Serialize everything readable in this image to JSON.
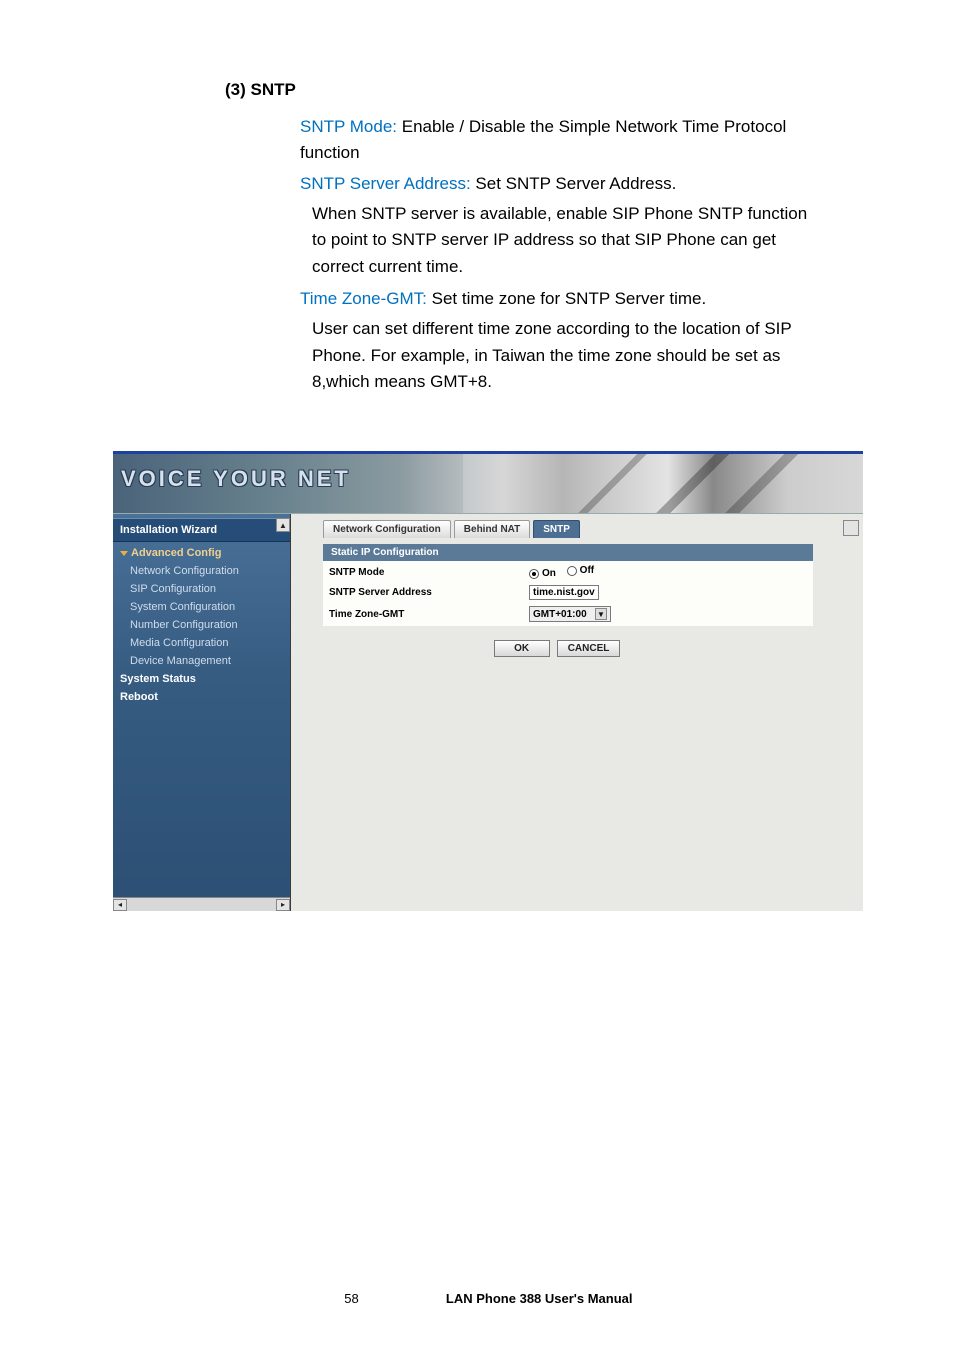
{
  "doc": {
    "heading": "(3) SNTP",
    "p1_label": "SNTP Mode:",
    "p1_text": " Enable / Disable the Simple Network Time Protocol function",
    "p2_label": "SNTP Server Address:",
    "p2_text": " Set SNTP Server Address.",
    "p2_sub": "When SNTP server is available, enable SIP Phone SNTP function to point to SNTP server IP address so that SIP Phone can get correct current time.",
    "p3_label": "Time Zone-GMT:",
    "p3_text": " Set time zone for SNTP Server time.",
    "p3_sub": "User can set different time zone according to the location of SIP Phone. For example, in Taiwan the time zone should be set as 8,which means GMT+8."
  },
  "banner_brand": "VOICE YOUR NET",
  "sidebar": {
    "wizard": "Installation Wizard",
    "section": "Advanced Config",
    "items": [
      "Network Configuration",
      "SIP Configuration",
      "System Configuration",
      "Number Configuration",
      "Media Configuration",
      "Device Management"
    ],
    "status": "System Status",
    "reboot": "Reboot"
  },
  "tabs": [
    "Network Configuration",
    "Behind NAT",
    "SNTP"
  ],
  "panel_title": "Static IP Configuration",
  "form": {
    "mode_label": "SNTP Mode",
    "mode_on": "On",
    "mode_off": "Off",
    "addr_label": "SNTP Server Address",
    "addr_value": "time.nist.gov",
    "tz_label": "Time Zone-GMT",
    "tz_value": "GMT+01:00"
  },
  "buttons": {
    "ok": "OK",
    "cancel": "CANCEL"
  },
  "footer": {
    "page": "58",
    "title": "LAN Phone 388 User's Manual"
  }
}
